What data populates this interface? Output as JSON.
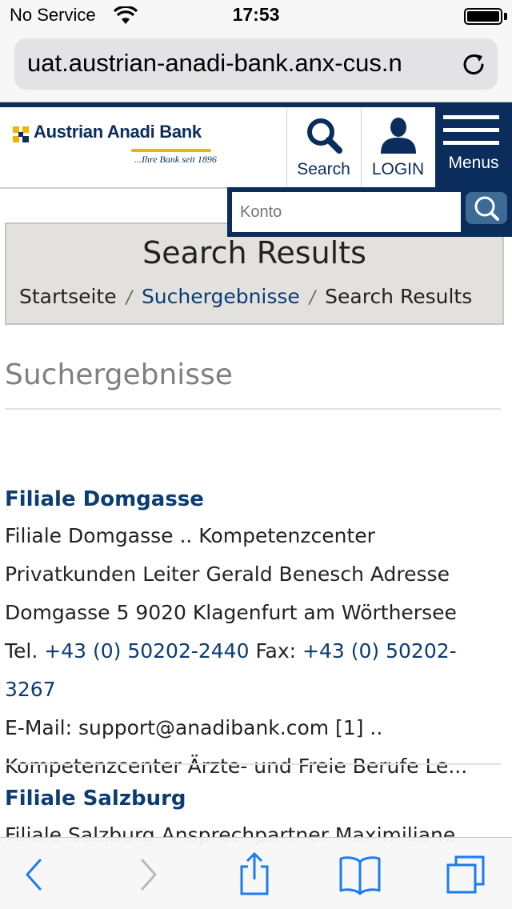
{
  "status_bar": {
    "carrier": "No Service",
    "time": "17:53"
  },
  "browser": {
    "url": "uat.austrian-anadi-bank.anx-cus.n"
  },
  "header": {
    "logo_name": "Austrian Anadi Bank",
    "logo_tagline": "...Ihre Bank seit 1896",
    "search_label": "Search",
    "login_label": "LOGIN",
    "menu_label": "Menus"
  },
  "search": {
    "placeholder": "Konto"
  },
  "results_box": {
    "title": "Search Results",
    "breadcrumb": {
      "home": "Startseite",
      "separator": "/",
      "middle": "Suchergebnisse",
      "current": "Search Results"
    }
  },
  "page": {
    "heading": "Suchergebnisse"
  },
  "results": [
    {
      "title": "Filiale Domgasse",
      "line1": "Filiale Domgasse .. Kompetenzcenter",
      "line2": "Privatkunden Leiter Gerald Benesch Adresse",
      "line3": "Domgasse 5 9020 Klagenfurt am Wörthersee",
      "tel_label": "Tel.",
      "tel": "+43 (0) 50202-2440",
      "fax_label": "Fax:",
      "fax": "+43 (0) 50202-3267",
      "line5": "E-Mail: support@anadibank.com [1] ..",
      "line6": "Kompetenzcenter Ärzte- und Freie Berufe Le..."
    },
    {
      "title": "Filiale Salzburg",
      "line1": "Filiale Salzburg Ansprechpartner Maximiliane"
    }
  ],
  "colors": {
    "brand_navy": "#0b2d5c",
    "link_blue": "#0b3c72",
    "logo_gold": "#f0b400",
    "ios_blue": "#1a7cf0"
  }
}
